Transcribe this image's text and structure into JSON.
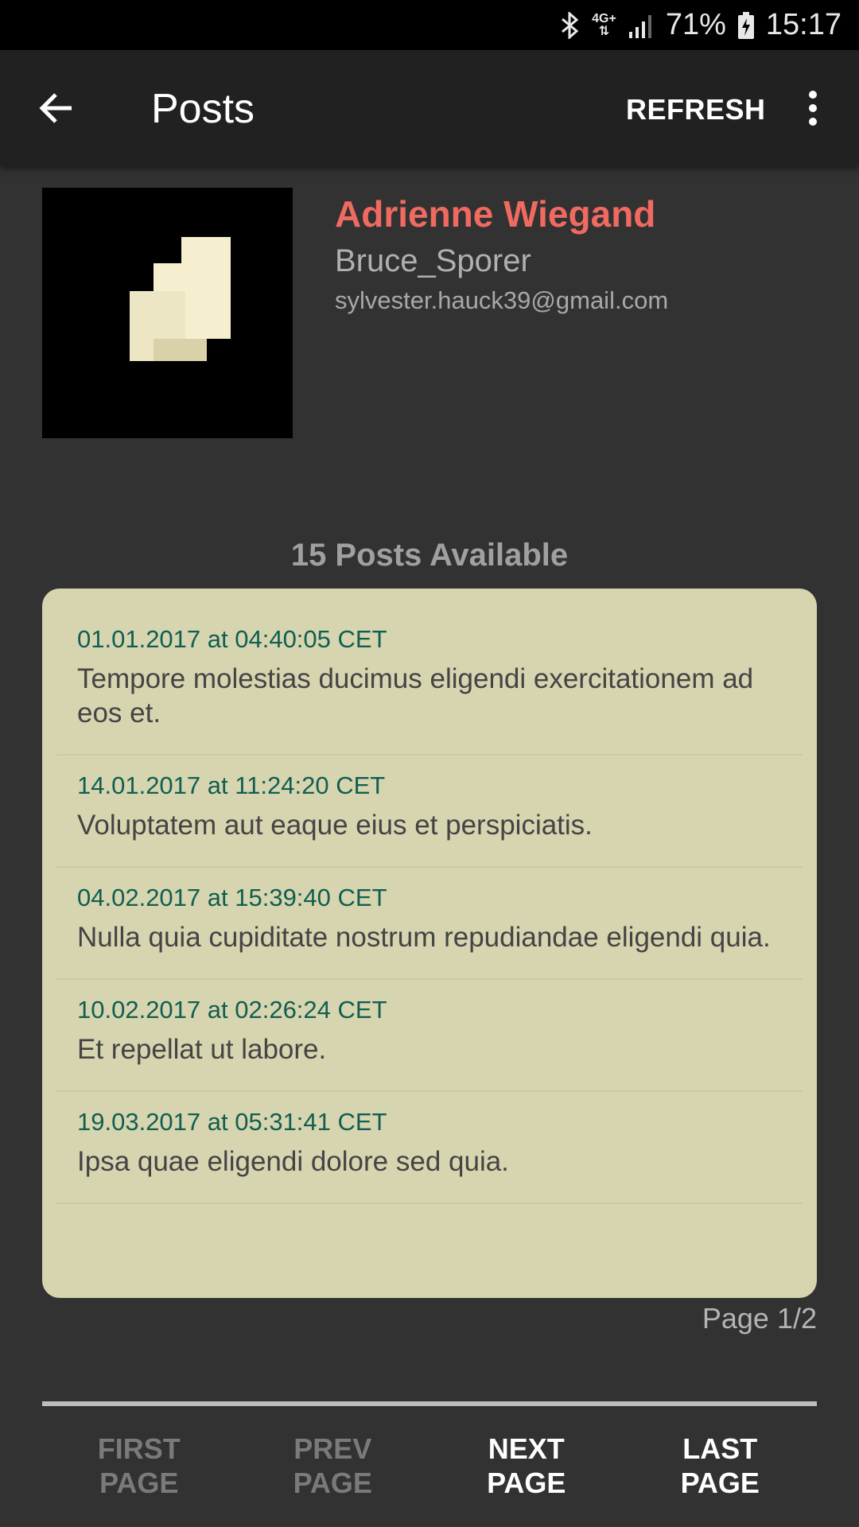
{
  "status_bar": {
    "network": "4G+",
    "battery": "71%",
    "time": "15:17"
  },
  "appbar": {
    "title": "Posts",
    "refresh_label": "REFRESH"
  },
  "profile": {
    "name": "Adrienne Wiegand",
    "username": "Bruce_Sporer",
    "email": "sylvester.hauck39@gmail.com"
  },
  "posts_count_label": "15 Posts Available",
  "posts": [
    {
      "date": "01.01.2017 at 04:40:05 CET",
      "text": "Tempore molestias ducimus eligendi exercitationem ad eos et."
    },
    {
      "date": "14.01.2017 at 11:24:20 CET",
      "text": "Voluptatem aut eaque eius et perspiciatis."
    },
    {
      "date": "04.02.2017 at 15:39:40 CET",
      "text": "Nulla quia cupiditate nostrum repudiandae eligendi quia."
    },
    {
      "date": "10.02.2017 at 02:26:24 CET",
      "text": "Et repellat ut labore."
    },
    {
      "date": "19.03.2017 at 05:31:41 CET",
      "text": "Ipsa quae eligendi dolore sed quia."
    }
  ],
  "page_indicator": "Page 1/2",
  "pager": {
    "first": "FIRST\nPAGE",
    "prev": "PREV\nPAGE",
    "next": "NEXT\nPAGE",
    "last": "LAST\nPAGE"
  },
  "colors": {
    "accent_name": "#ef6a60",
    "card_bg": "#d7d4b0",
    "post_date": "#0f5f50"
  }
}
